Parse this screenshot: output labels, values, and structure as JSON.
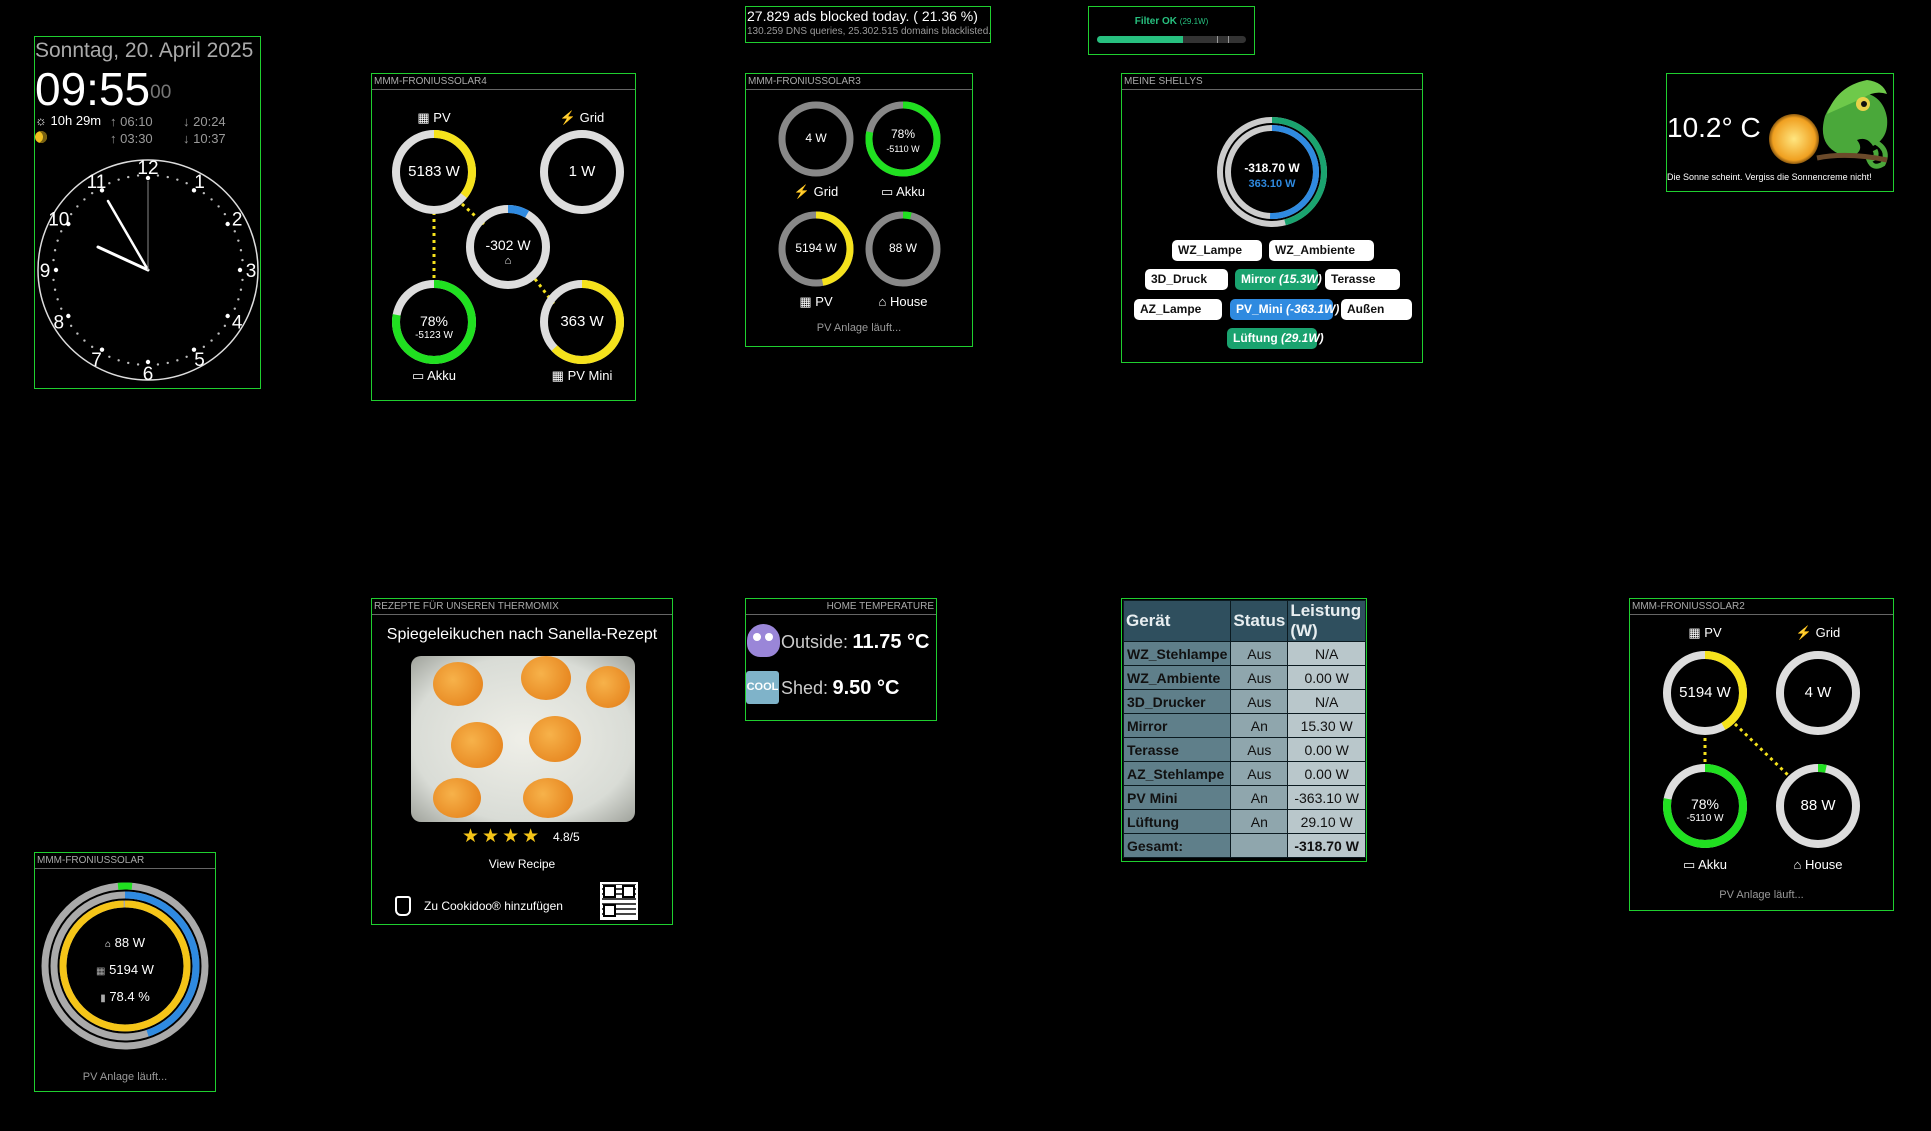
{
  "clock": {
    "date": "Sonntag, 20. April 2025",
    "time_hm": "09:55",
    "time_s": "00",
    "sun_duration": "10h 29m",
    "sunrise": "06:10",
    "sunset": "20:24",
    "moonrise": "03:30",
    "moonset": "10:37",
    "dial_numbers": [
      "12",
      "1",
      "2",
      "3",
      "4",
      "5",
      "6",
      "7",
      "8",
      "9",
      "10",
      "11"
    ]
  },
  "pihole": {
    "ads_line": "27.829 ads blocked today. ( 21.36 %)",
    "dns_line": "130.259 DNS queries, 25.302.515 domains blacklisted."
  },
  "filter": {
    "label": "Filter OK",
    "power": "(29.1W)",
    "level_percent": 58
  },
  "solar4": {
    "header": "MMM-FRONIUSSOLAR4",
    "pv_label": "PV",
    "pv_value": "5183 W",
    "grid_label": "Grid",
    "grid_value": "1 W",
    "house_value": "-302 W",
    "akku_label": "Akku",
    "akku_percent": "78%",
    "akku_power": "-5123 W",
    "pvmini_label": "PV Mini",
    "pvmini_value": "363 W"
  },
  "solar3": {
    "header": "MMM-FRONIUSSOLAR3",
    "grid_value": "4 W",
    "grid_label": "Grid",
    "akku_percent": "78%",
    "akku_power": "-5110 W",
    "akku_label": "Akku",
    "pv_value": "5194 W",
    "pv_label": "PV",
    "house_value": "88 W",
    "house_label": "House",
    "status": "PV Anlage läuft..."
  },
  "shellys": {
    "header": "MEINE SHELLYS",
    "total": "-318.70 W",
    "production": "363.10 W",
    "chips": [
      {
        "name": "WZ_Lampe",
        "power": ""
      },
      {
        "name": "WZ_Ambiente",
        "power": ""
      },
      {
        "name": "3D_Druck",
        "power": ""
      },
      {
        "name": "Mirror",
        "power": "(15.3W)"
      },
      {
        "name": "Terasse",
        "power": ""
      },
      {
        "name": "AZ_Lampe",
        "power": ""
      },
      {
        "name": "PV_Mini",
        "power": "(-363.1W)"
      },
      {
        "name": "Außen",
        "power": ""
      },
      {
        "name": "Lüftung",
        "power": "(29.1W)"
      }
    ]
  },
  "weather": {
    "temperature": "10.2° C",
    "message": "Die Sonne scheint. Vergiss die Sonnencreme nicht!"
  },
  "recipe": {
    "header": "REZEPTE FÜR UNSEREN THERMOMIX",
    "title": "Spiegeleikuchen nach Sanella-Rezept",
    "rating": "4.8/5",
    "view_label": "View Recipe",
    "cookidoo_label": "Zu Cookidoo® hinzufügen"
  },
  "home_temp": {
    "header": "HOME TEMPERATURE",
    "outside_label": "Outside:",
    "outside_value": "11.75 °C",
    "shed_label": "Shed:",
    "shed_value": "9.50 °C",
    "cool_badge": "COOL"
  },
  "status_table": {
    "headers": [
      "Gerät",
      "Status",
      "Leistung (W)"
    ],
    "rows": [
      [
        "WZ_Stehlampe",
        "Aus",
        "N/A"
      ],
      [
        "WZ_Ambiente",
        "Aus",
        "0.00 W"
      ],
      [
        "3D_Drucker",
        "Aus",
        "N/A"
      ],
      [
        "Mirror",
        "An",
        "15.30 W"
      ],
      [
        "Terasse",
        "Aus",
        "0.00 W"
      ],
      [
        "AZ_Stehlampe",
        "Aus",
        "0.00 W"
      ],
      [
        "PV Mini",
        "An",
        "-363.10 W"
      ],
      [
        "Lüftung",
        "An",
        "29.10 W"
      ]
    ],
    "total_label": "Gesamt:",
    "total_value": "-318.70 W"
  },
  "solar2": {
    "header": "MMM-FRONIUSSOLAR2",
    "pv_label": "PV",
    "pv_value": "5194 W",
    "grid_label": "Grid",
    "grid_value": "4 W",
    "akku_percent": "78%",
    "akku_power": "-5110 W",
    "akku_label": "Akku",
    "house_value": "88 W",
    "house_label": "House",
    "status": "PV Anlage läuft..."
  },
  "solar1": {
    "header": "MMM-FRONIUSSOLAR",
    "house_value": "88 W",
    "pv_value": "5194 W",
    "akku_value": "78.4 %",
    "status": "PV Anlage läuft..."
  },
  "colors": {
    "module_border": "#1fcf2f",
    "pv_yellow": "#f5e21c",
    "akku_green": "#20e020",
    "blue": "#2f8ae0",
    "teal": "#1aa36f"
  }
}
